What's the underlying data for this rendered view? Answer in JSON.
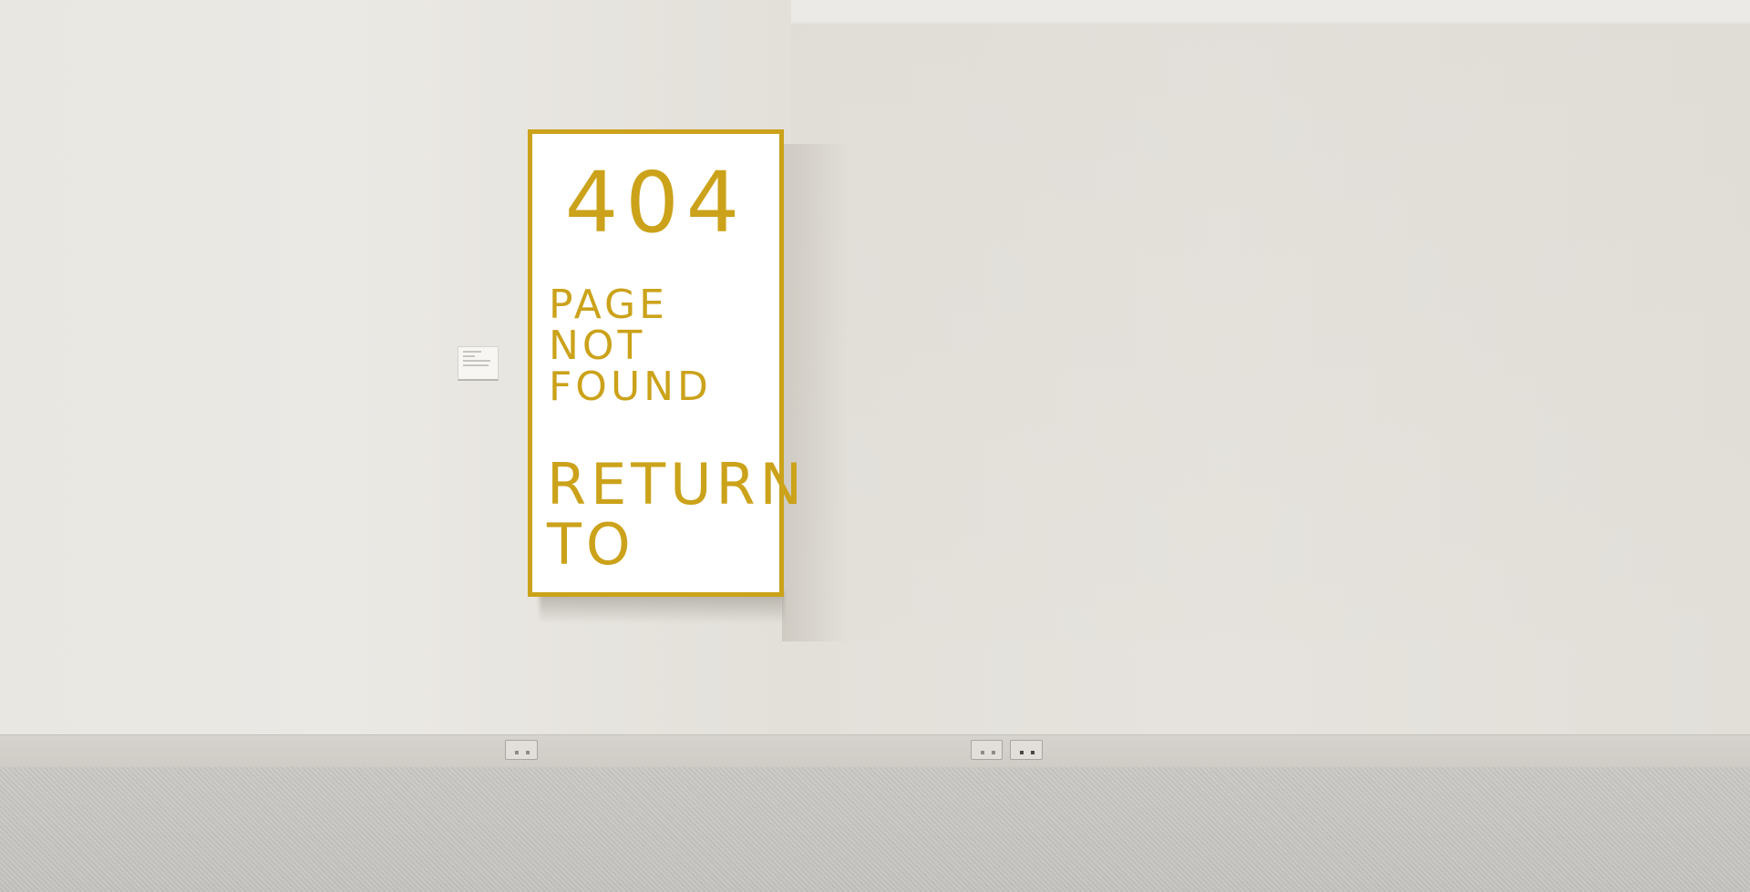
{
  "error": {
    "code": "404",
    "message_lines": [
      "PAGE",
      "NOT",
      "FOUND"
    ],
    "return_link_lines": [
      "RETURN",
      "TO"
    ]
  },
  "colors": {
    "accent": "#cba21a",
    "wall": "#e7e5e0",
    "floor": "#c8c6c2"
  }
}
